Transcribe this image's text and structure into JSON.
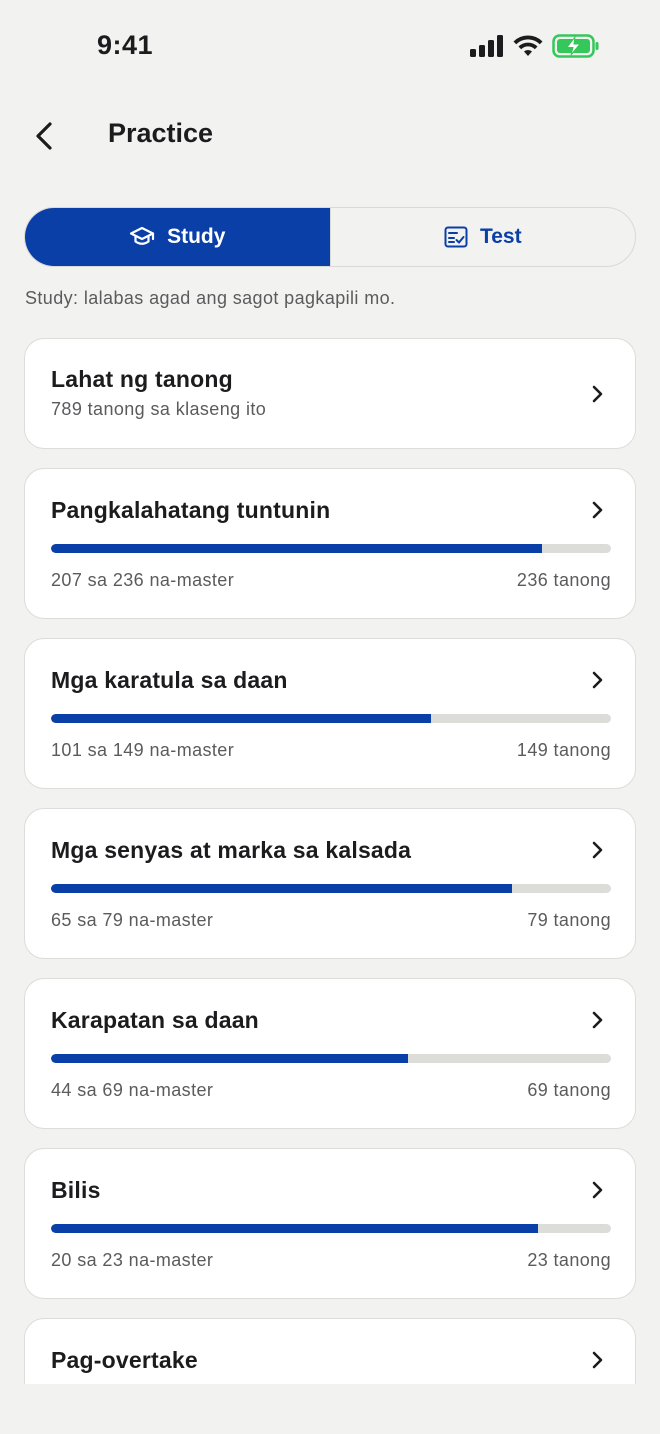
{
  "status_bar": {
    "time": "9:41",
    "icons": [
      "cellular-signal-icon",
      "wifi-icon",
      "battery-charging-icon"
    ],
    "battery_color": "#34c759"
  },
  "nav": {
    "title": "Practice",
    "back_icon": "chevron-left-icon"
  },
  "mode_toggle": {
    "study_label": "Study",
    "study_icon": "graduation-cap-icon",
    "test_label": "Test",
    "test_icon": "checklist-icon",
    "selected": "Study"
  },
  "hint": "Study: lalabas agad ang sagot pagkapili mo.",
  "all_questions": {
    "title": "Lahat ng tanong",
    "subtitle": "789 tanong sa klaseng ito"
  },
  "categories": [
    {
      "title": "Pangkalahatang tuntunin",
      "mastered_text": "207 sa 236 na-master",
      "total_text": "236 tanong",
      "mastered": 207,
      "total": 236
    },
    {
      "title": "Mga karatula sa daan",
      "mastered_text": "101 sa 149 na-master",
      "total_text": "149 tanong",
      "mastered": 101,
      "total": 149
    },
    {
      "title": "Mga senyas at marka sa kalsada",
      "mastered_text": "65 sa 79 na-master",
      "total_text": "79 tanong",
      "mastered": 65,
      "total": 79
    },
    {
      "title": "Karapatan sa daan",
      "mastered_text": "44 sa 69 na-master",
      "total_text": "69 tanong",
      "mastered": 44,
      "total": 69
    },
    {
      "title": "Bilis",
      "mastered_text": "20 sa 23 na-master",
      "total_text": "23 tanong",
      "mastered": 20,
      "total": 23
    },
    {
      "title": "Pag-overtake"
    }
  ],
  "colors": {
    "accent": "#0a3fa8",
    "background": "#f2f2f0",
    "track": "#dcdcd8"
  }
}
